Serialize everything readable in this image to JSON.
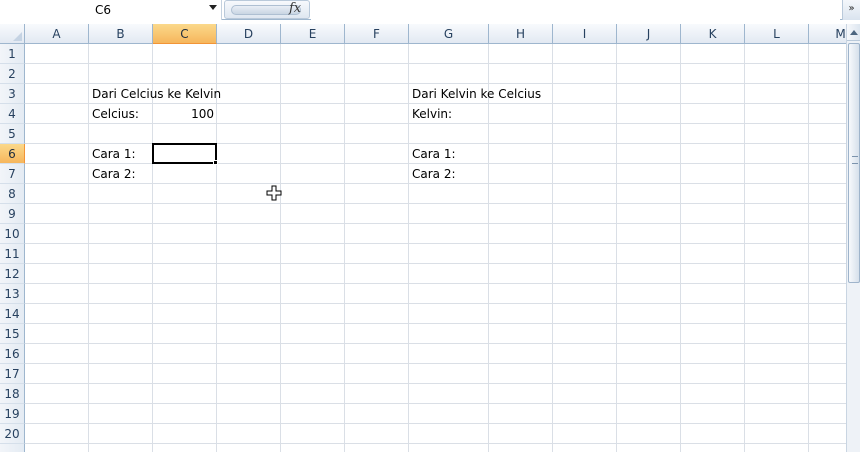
{
  "formula_bar": {
    "name_box": "C6",
    "fx_label": "fx",
    "formula_value": "",
    "expand_glyph": "»"
  },
  "columns": [
    "A",
    "B",
    "C",
    "D",
    "E",
    "F",
    "G",
    "H",
    "I",
    "J",
    "K",
    "L",
    "M"
  ],
  "rows": [
    "1",
    "2",
    "3",
    "4",
    "5",
    "6",
    "7",
    "8",
    "9",
    "10",
    "11",
    "12",
    "13",
    "14",
    "15",
    "16",
    "17",
    "18",
    "19",
    "20"
  ],
  "selected_column": "C",
  "selected_row": "6",
  "cells": {
    "B3": "Dari Celcius ke Kelvin",
    "B4": "Celcius:",
    "C4": "100",
    "B6": "Cara 1:",
    "B7": "Cara 2:",
    "G3": "Dari Kelvin ke Celcius",
    "G4": "Kelvin:",
    "G6": "Cara 1:",
    "G7": "Cara 2:"
  },
  "colors": {
    "header_selected": "#f6b65c",
    "gridline": "#dadfe6",
    "header_border": "#9eb6ce"
  },
  "icons": {
    "name_box_dropdown": "chevron-down-icon",
    "function": "fx-icon",
    "cursor": "cell-select-cursor-icon"
  }
}
